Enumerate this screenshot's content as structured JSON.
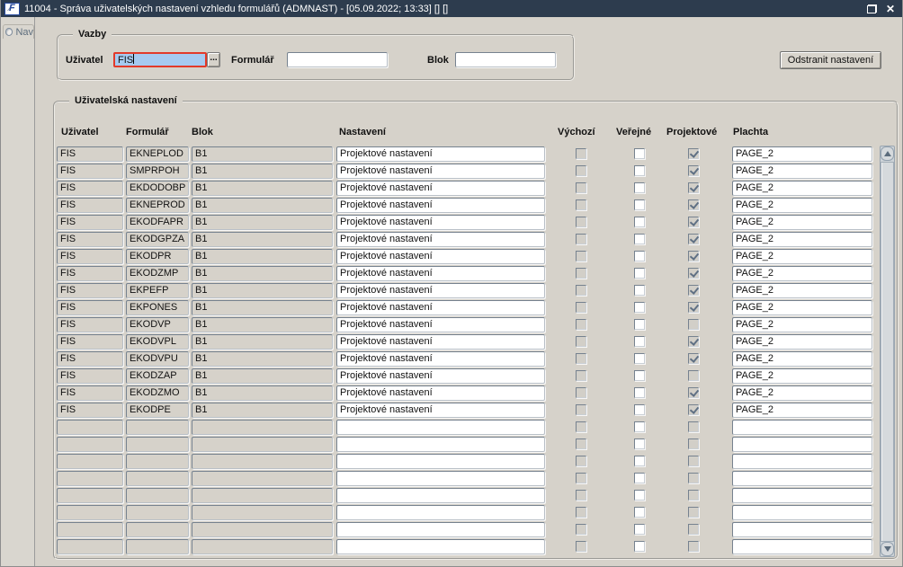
{
  "window": {
    "title": "11004 - Správa uživatelských nastavení vzhledu formulářů (ADMNAST) - [05.09.2022; 13:33] [] []",
    "logo_letter": "F",
    "close_glyph": "✕"
  },
  "nav_tab": {
    "label": "Nav"
  },
  "vazby": {
    "legend": "Vazby",
    "uzivatel_label": "Uživatel",
    "uzivatel_value": "FIS",
    "lov_button": "...",
    "formular_label": "Formulář",
    "formular_value": "",
    "blok_label": "Blok",
    "blok_value": ""
  },
  "actions": {
    "odstranit_label": "Odstranit nastavení"
  },
  "table": {
    "legend": "Uživatelská nastavení",
    "headers": {
      "uzivatel": "Uživatel",
      "formular": "Formulář",
      "blok": "Blok",
      "nastaveni": "Nastavení",
      "vychozi": "Výchozí",
      "verejne": "Veřejné",
      "projektove": "Projektové",
      "plachta": "Plachta"
    },
    "rows": [
      {
        "uzivatel": "FIS",
        "formular": "EKNEPLOD",
        "blok": "B1",
        "nastaveni": "Projektové nastavení",
        "vychozi": false,
        "verejne": false,
        "projektove": true,
        "plachta": "PAGE_2"
      },
      {
        "uzivatel": "FIS",
        "formular": "SMPRPOH",
        "blok": "B1",
        "nastaveni": "Projektové nastavení",
        "vychozi": false,
        "verejne": false,
        "projektove": true,
        "plachta": "PAGE_2"
      },
      {
        "uzivatel": "FIS",
        "formular": "EKDODOBP",
        "blok": "B1",
        "nastaveni": "Projektové nastavení",
        "vychozi": false,
        "verejne": false,
        "projektove": true,
        "plachta": "PAGE_2"
      },
      {
        "uzivatel": "FIS",
        "formular": "EKNEPROD",
        "blok": "B1",
        "nastaveni": "Projektové nastavení",
        "vychozi": false,
        "verejne": false,
        "projektove": true,
        "plachta": "PAGE_2"
      },
      {
        "uzivatel": "FIS",
        "formular": "EKODFAPR",
        "blok": "B1",
        "nastaveni": "Projektové nastavení",
        "vychozi": false,
        "verejne": false,
        "projektove": true,
        "plachta": "PAGE_2"
      },
      {
        "uzivatel": "FIS",
        "formular": "EKODGPZA",
        "blok": "B1",
        "nastaveni": "Projektové nastavení",
        "vychozi": false,
        "verejne": false,
        "projektove": true,
        "plachta": "PAGE_2"
      },
      {
        "uzivatel": "FIS",
        "formular": "EKODPR",
        "blok": "B1",
        "nastaveni": "Projektové nastavení",
        "vychozi": false,
        "verejne": false,
        "projektove": true,
        "plachta": "PAGE_2"
      },
      {
        "uzivatel": "FIS",
        "formular": "EKODZMP",
        "blok": "B1",
        "nastaveni": "Projektové nastavení",
        "vychozi": false,
        "verejne": false,
        "projektove": true,
        "plachta": "PAGE_2"
      },
      {
        "uzivatel": "FIS",
        "formular": "EKPEFP",
        "blok": "B1",
        "nastaveni": "Projektové nastavení",
        "vychozi": false,
        "verejne": false,
        "projektove": true,
        "plachta": "PAGE_2"
      },
      {
        "uzivatel": "FIS",
        "formular": "EKPONES",
        "blok": "B1",
        "nastaveni": "Projektové nastavení",
        "vychozi": false,
        "verejne": false,
        "projektove": true,
        "plachta": "PAGE_2"
      },
      {
        "uzivatel": "FIS",
        "formular": "EKODVP",
        "blok": "B1",
        "nastaveni": "Projektové nastavení",
        "vychozi": false,
        "verejne": false,
        "projektove": false,
        "plachta": "PAGE_2"
      },
      {
        "uzivatel": "FIS",
        "formular": "EKODVPL",
        "blok": "B1",
        "nastaveni": "Projektové nastavení",
        "vychozi": false,
        "verejne": false,
        "projektove": true,
        "plachta": "PAGE_2"
      },
      {
        "uzivatel": "FIS",
        "formular": "EKODVPU",
        "blok": "B1",
        "nastaveni": "Projektové nastavení",
        "vychozi": false,
        "verejne": false,
        "projektove": true,
        "plachta": "PAGE_2"
      },
      {
        "uzivatel": "FIS",
        "formular": "EKODZAP",
        "blok": "B1",
        "nastaveni": "Projektové nastavení",
        "vychozi": false,
        "verejne": false,
        "projektove": false,
        "plachta": "PAGE_2"
      },
      {
        "uzivatel": "FIS",
        "formular": "EKODZMO",
        "blok": "B1",
        "nastaveni": "Projektové nastavení",
        "vychozi": false,
        "verejne": false,
        "projektove": true,
        "plachta": "PAGE_2"
      },
      {
        "uzivatel": "FIS",
        "formular": "EKODPE",
        "blok": "B1",
        "nastaveni": "Projektové nastavení",
        "vychozi": false,
        "verejne": false,
        "projektove": true,
        "plachta": "PAGE_2"
      }
    ],
    "empty_rows": 8
  },
  "colors": {
    "titlebar": "#2d3c4e",
    "canvas": "#d6d2ca",
    "selection": "#a6caf0",
    "focus_border": "#e23a2a"
  }
}
